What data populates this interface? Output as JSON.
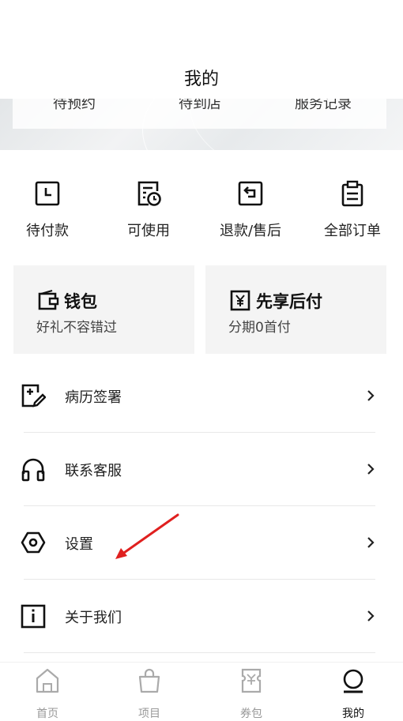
{
  "header": {
    "title": "我的"
  },
  "status_strip": {
    "items": [
      "待预约",
      "待到店",
      "服务记录"
    ]
  },
  "orders": [
    {
      "label": "待付款",
      "icon": "clock-icon"
    },
    {
      "label": "可使用",
      "icon": "ticket-clock-icon"
    },
    {
      "label": "退款/售后",
      "icon": "return-icon"
    },
    {
      "label": "全部订单",
      "icon": "clipboard-icon"
    }
  ],
  "cards": [
    {
      "title": "钱包",
      "subtitle": "好礼不容错过",
      "icon": "wallet-icon"
    },
    {
      "title": "先享后付",
      "subtitle": "分期0首付",
      "icon": "yen-icon"
    }
  ],
  "menu": [
    {
      "label": "病历签署",
      "icon": "sign-document-icon"
    },
    {
      "label": "联系客服",
      "icon": "headphones-icon"
    },
    {
      "label": "设置",
      "icon": "settings-hexagon-icon"
    },
    {
      "label": "关于我们",
      "icon": "info-icon"
    }
  ],
  "tabbar": [
    {
      "label": "首页",
      "icon": "home-icon",
      "active": false
    },
    {
      "label": "项目",
      "icon": "bag-icon",
      "active": false
    },
    {
      "label": "券包",
      "icon": "coupon-icon",
      "active": false
    },
    {
      "label": "我的",
      "icon": "profile-icon",
      "active": true
    }
  ],
  "colors": {
    "annotation_arrow": "#e0201f",
    "active_tab": "#111111",
    "inactive_tab": "#999999",
    "card_bg": "#f4f4f4"
  }
}
